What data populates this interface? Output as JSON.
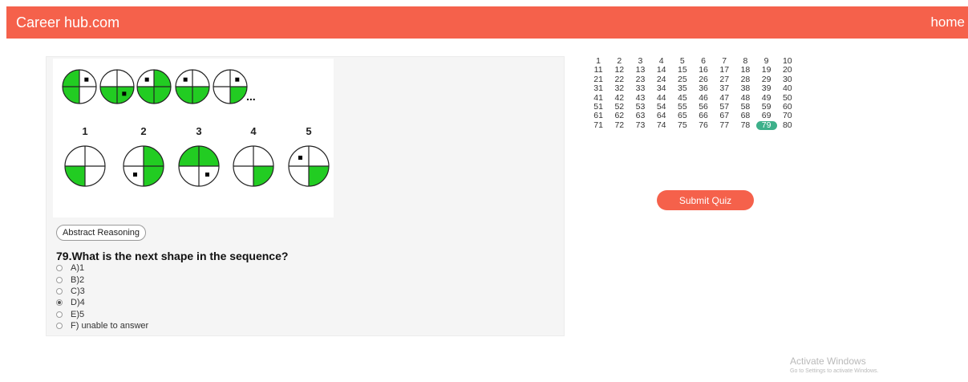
{
  "header": {
    "brand": "Career hub.com",
    "home_label": "home",
    "color": "#f5614b"
  },
  "figure": {
    "sequence_ellipsis": "...",
    "sequence": [
      {
        "green": [
          "lt",
          "lb"
        ],
        "dot": "rt"
      },
      {
        "green": [
          "lb",
          "rb"
        ],
        "dot": "rb"
      },
      {
        "green": [
          "lb",
          "rb",
          "rt"
        ],
        "dot": "lt"
      },
      {
        "green": [
          "lb",
          "rb"
        ],
        "dot": "lt"
      },
      {
        "green": [
          "rb"
        ],
        "dot": "rt"
      }
    ],
    "answers": [
      {
        "label": "1",
        "green": [
          "lb"
        ],
        "dot": null
      },
      {
        "label": "2",
        "green": [
          "rt",
          "rb"
        ],
        "dot": "lb"
      },
      {
        "label": "3",
        "green": [
          "lt",
          "rt"
        ],
        "dot": "rb"
      },
      {
        "label": "4",
        "green": [
          "rb"
        ],
        "dot": null
      },
      {
        "label": "5",
        "green": [
          "rb"
        ],
        "dot": "lt"
      }
    ],
    "shape_color": "#22cc22"
  },
  "category": "Abstract Reasoning",
  "question": "79.What is the next shape in the sequence?",
  "options": [
    {
      "label": "A)1",
      "selected": false
    },
    {
      "label": "B)2",
      "selected": false
    },
    {
      "label": "C)3",
      "selected": false
    },
    {
      "label": "D)4",
      "selected": true
    },
    {
      "label": "E)5",
      "selected": false
    },
    {
      "label": "F) unable to answer",
      "selected": false
    }
  ],
  "question_nav": {
    "total": 80,
    "current": 79,
    "current_color": "#3db08a"
  },
  "submit_label": "Submit Quiz",
  "watermark": {
    "title": "Activate Windows",
    "subtitle": "Go to Settings to activate Windows."
  }
}
